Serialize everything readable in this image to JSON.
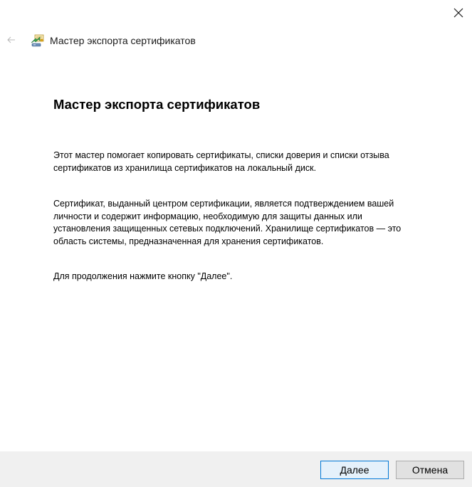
{
  "window": {
    "close_icon": "close-icon"
  },
  "header": {
    "back_icon": "back-arrow-icon",
    "wizard_icon": "certificate-wizard-icon",
    "title": "Мастер экспорта сертификатов"
  },
  "main": {
    "title": "Мастер экспорта сертификатов",
    "paragraph1": [
      "Этот мастер помогает копировать сертификаты, списки доверия и списки отзыва",
      "сертификатов из хранилища сертификатов на локальный диск."
    ],
    "paragraph2": [
      "Сертификат, выданный центром сертификации, является подтверждением вашей",
      "личности и содержит информацию, необходимую для защиты данных или",
      "установления защищенных сетевых подключений. Хранилище сертификатов — это",
      "область системы, предназначенная для хранения сертификатов."
    ],
    "paragraph3": [
      "Для продолжения нажмите кнопку \"Далее\"."
    ]
  },
  "footer": {
    "next_label": "Далее",
    "cancel_label": "Отмена"
  },
  "colors": {
    "accent": "#0078d7",
    "footer_bg": "#f0f0f0"
  }
}
